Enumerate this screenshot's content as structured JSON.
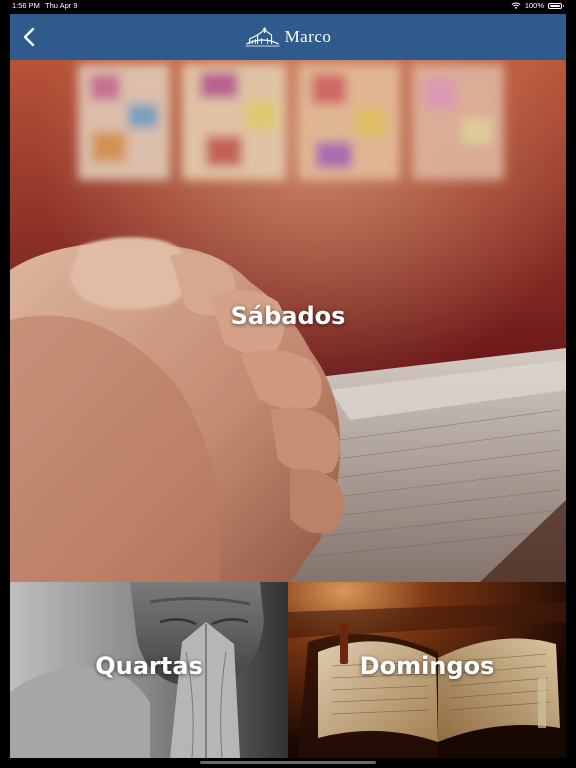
{
  "status_bar": {
    "time": "1:56 PM",
    "date": "Thu Apr 9",
    "battery": "100%",
    "battery_level": 1.0
  },
  "nav": {
    "back_icon": "chevron-left-icon",
    "logo_text": "Marco",
    "logo_icon": "church-icon",
    "bar_color": "#2e5a8c"
  },
  "tiles": [
    {
      "label": "Sábados",
      "image": "praying-hands-stained-glass"
    },
    {
      "label": "Quartas",
      "image": "man-praying-grayscale"
    },
    {
      "label": "Domingos",
      "image": "open-bible-candlelight"
    }
  ]
}
